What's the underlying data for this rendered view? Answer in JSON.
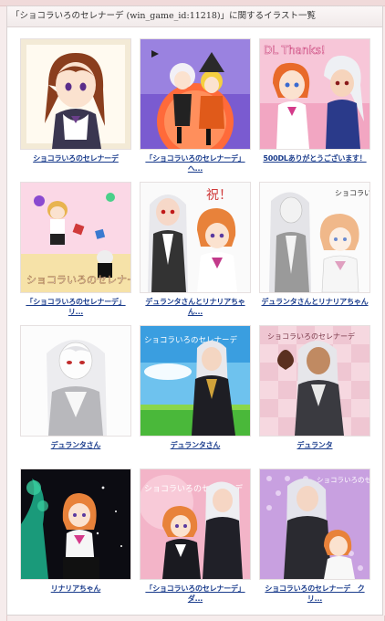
{
  "page": {
    "title": "「ショコラいろのセレナーデ (win_game_id:11218)」に関するイラスト一覧"
  },
  "illustrations": [
    {
      "caption": "ショコラいろのセレナーデ",
      "icon": "anime-girl-portrait"
    },
    {
      "caption": "「ショコラいろのセレナーデ」へ...",
      "icon": "halloween-girls-illustration"
    },
    {
      "caption": "500DLありがとうございます！",
      "icon": "thanks-illustration",
      "art_text": "DL Thanks!"
    },
    {
      "caption": "「ショコラいろのセレナーデ」リ...",
      "icon": "chibi-title-illustration",
      "art_text": "ショコラいろのセレナーデ"
    },
    {
      "caption": "デュランタさんとリナリアちゃん...",
      "icon": "two-girls-illustration",
      "art_text": "祝！"
    },
    {
      "caption": "デュランタさんとリナリアちゃん",
      "icon": "sketch-two-girls-illustration",
      "art_text": "ショコラいろのセレナーデ"
    },
    {
      "caption": "デュランタさん",
      "icon": "white-hair-woman-sketch"
    },
    {
      "caption": "デュランタさん",
      "icon": "woman-sky-field-illustration",
      "art_text": "ショコラいろのセレナーデ"
    },
    {
      "caption": "デュランタ",
      "icon": "woman-chocolate-illustration",
      "art_text": "ショコラいろのセレナーデ"
    },
    {
      "caption": "リナリアちゃん",
      "icon": "girl-night-tree-illustration"
    },
    {
      "caption": "「ショコラいろのセレナーデ」ダ...",
      "icon": "two-women-pink-illustration",
      "art_text": "ショコラいろのセレナーデ"
    },
    {
      "caption": "ショコラいろのセレナーデ　ク リ...",
      "icon": "two-women-purple-illustration",
      "art_text": "ショコラいろのセレナーデ"
    }
  ]
}
